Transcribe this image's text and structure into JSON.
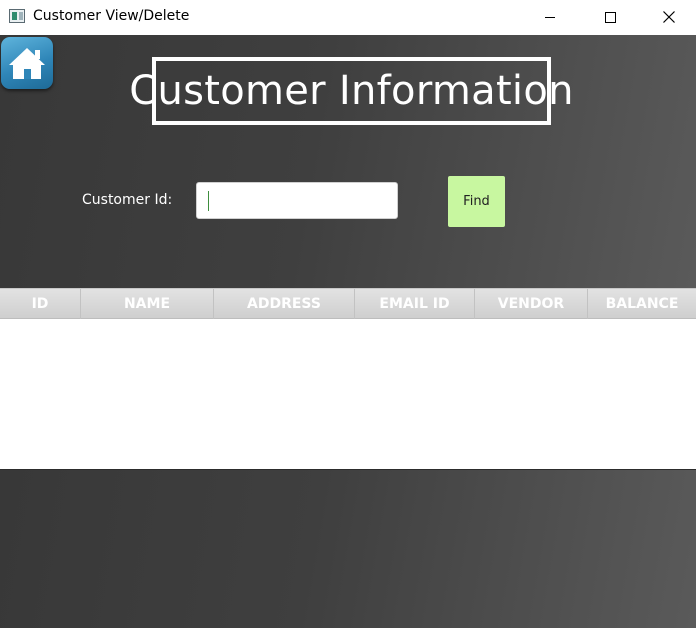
{
  "window": {
    "title": "Customer View/Delete",
    "controls": {
      "minimize": "minimize-icon",
      "maximize": "maximize-icon",
      "close": "close-icon"
    }
  },
  "header": {
    "title": "Customer Information",
    "home_icon": "home-icon"
  },
  "search": {
    "label": "Customer Id:",
    "value": "",
    "placeholder": "",
    "button_label": "Find"
  },
  "table": {
    "columns": [
      "ID",
      "NAME",
      "ADDRESS",
      "EMAIL ID",
      "VENDOR",
      "BALANCE"
    ],
    "rows": []
  },
  "colors": {
    "panel_background": "#3f3f3f",
    "find_button": "#c8f7a0",
    "home_button": "#2f86b8",
    "title_border": "#ffffff"
  }
}
